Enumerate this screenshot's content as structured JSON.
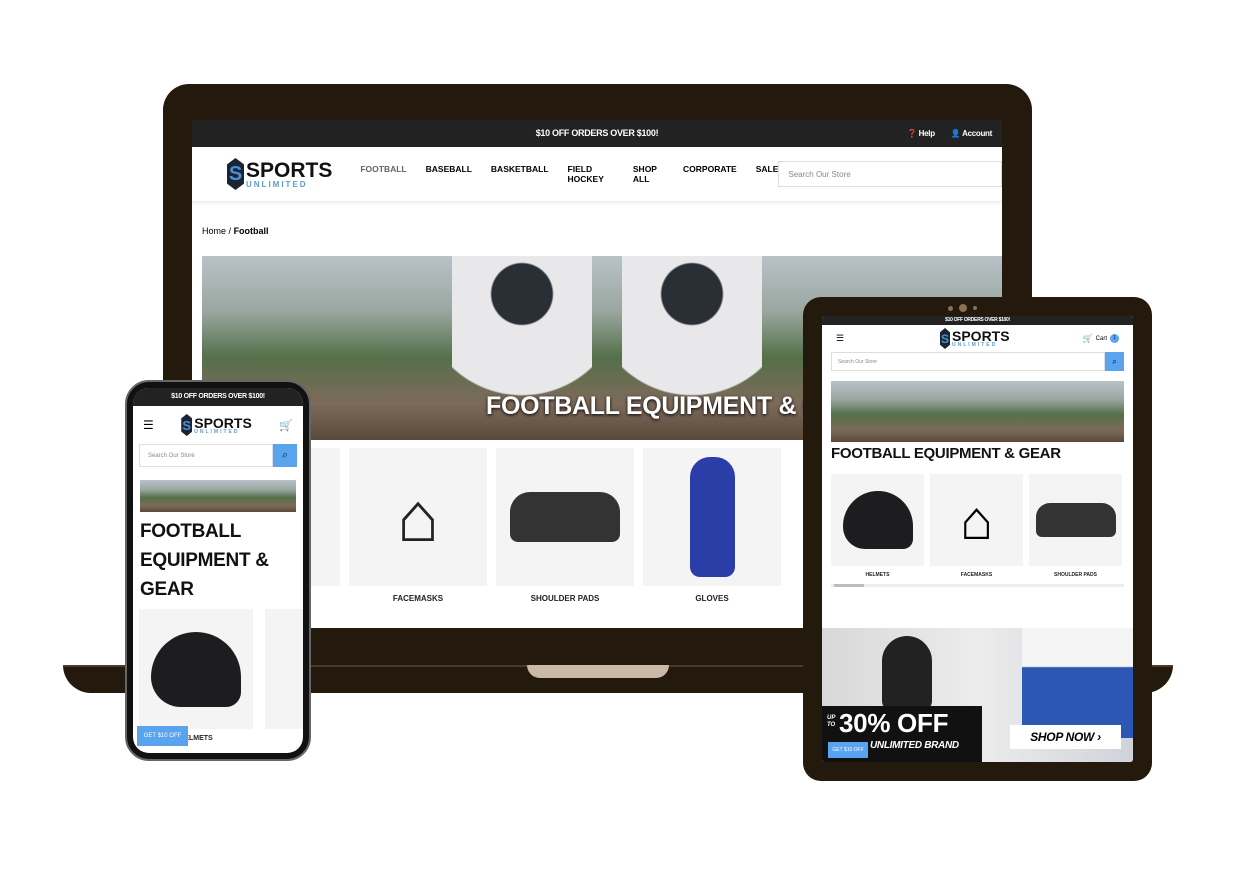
{
  "promo": "$10 OFF ORDERS OVER $100!",
  "header": {
    "help": "Help",
    "account": "Account",
    "search_placeholder": "Search Our Store",
    "cart": "Cart",
    "cart_count": "1"
  },
  "logo": {
    "top": "SPORTS",
    "bottom": "UNLIMITED",
    "mark": "S"
  },
  "nav": [
    "FOOTBALL",
    "BASEBALL",
    "BASKETBALL",
    "FIELD HOCKEY",
    "SHOP ALL",
    "CORPORATE",
    "SALE"
  ],
  "breadcrumb": {
    "home": "Home",
    "sep": "/",
    "current": "Football"
  },
  "hero_title": "FOOTBALL EQUIPMENT & GEAR",
  "phone_title": [
    "FOOTBALL",
    "EQUIPMENT & GEAR"
  ],
  "categories": [
    "HELMETS",
    "FACEMASKS",
    "SHOULDER PADS",
    "GLOVES"
  ],
  "banner": {
    "up_to": "UP TO",
    "discount": "30% OFF",
    "brand": "UNLIMITED BRAND",
    "shop_now": "SHOP NOW ›"
  },
  "get_offer": "GET $10 OFF",
  "colors": {
    "accent": "#5aa3ef",
    "frame": "#24190d",
    "promo_bar": "#222222"
  },
  "icons": {
    "help": "question-circle-icon",
    "account": "user-icon",
    "cart": "cart-icon",
    "search": "search-icon",
    "menu": "hamburger-icon"
  }
}
